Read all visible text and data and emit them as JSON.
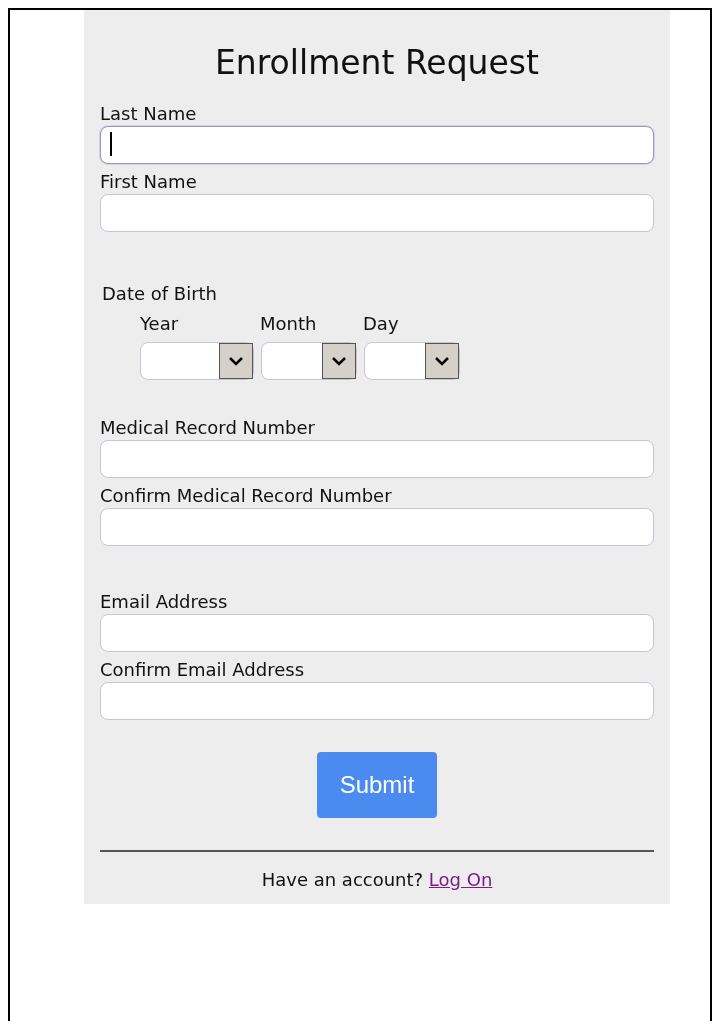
{
  "title": "Enrollment Request",
  "sections": [
    {
      "kind": "fields",
      "fields": [
        {
          "label": "Last Name",
          "focused": true
        },
        {
          "label": "First Name",
          "focused": false
        }
      ]
    },
    {
      "kind": "date",
      "label": "Date of Birth",
      "parts": [
        {
          "label": "Year"
        },
        {
          "label": "Month"
        },
        {
          "label": "Day"
        }
      ]
    },
    {
      "kind": "fields",
      "fields": [
        {
          "label": "Medical Record Number",
          "focused": false
        },
        {
          "label": "Confirm Medical Record Number",
          "focused": false
        }
      ]
    },
    {
      "kind": "fields",
      "fields": [
        {
          "label": "Email Address",
          "focused": false
        },
        {
          "label": "Confirm Email Address",
          "focused": false
        }
      ]
    }
  ],
  "submit": "Submit",
  "footer": {
    "text": "Have an account?",
    "link": "Log On"
  }
}
